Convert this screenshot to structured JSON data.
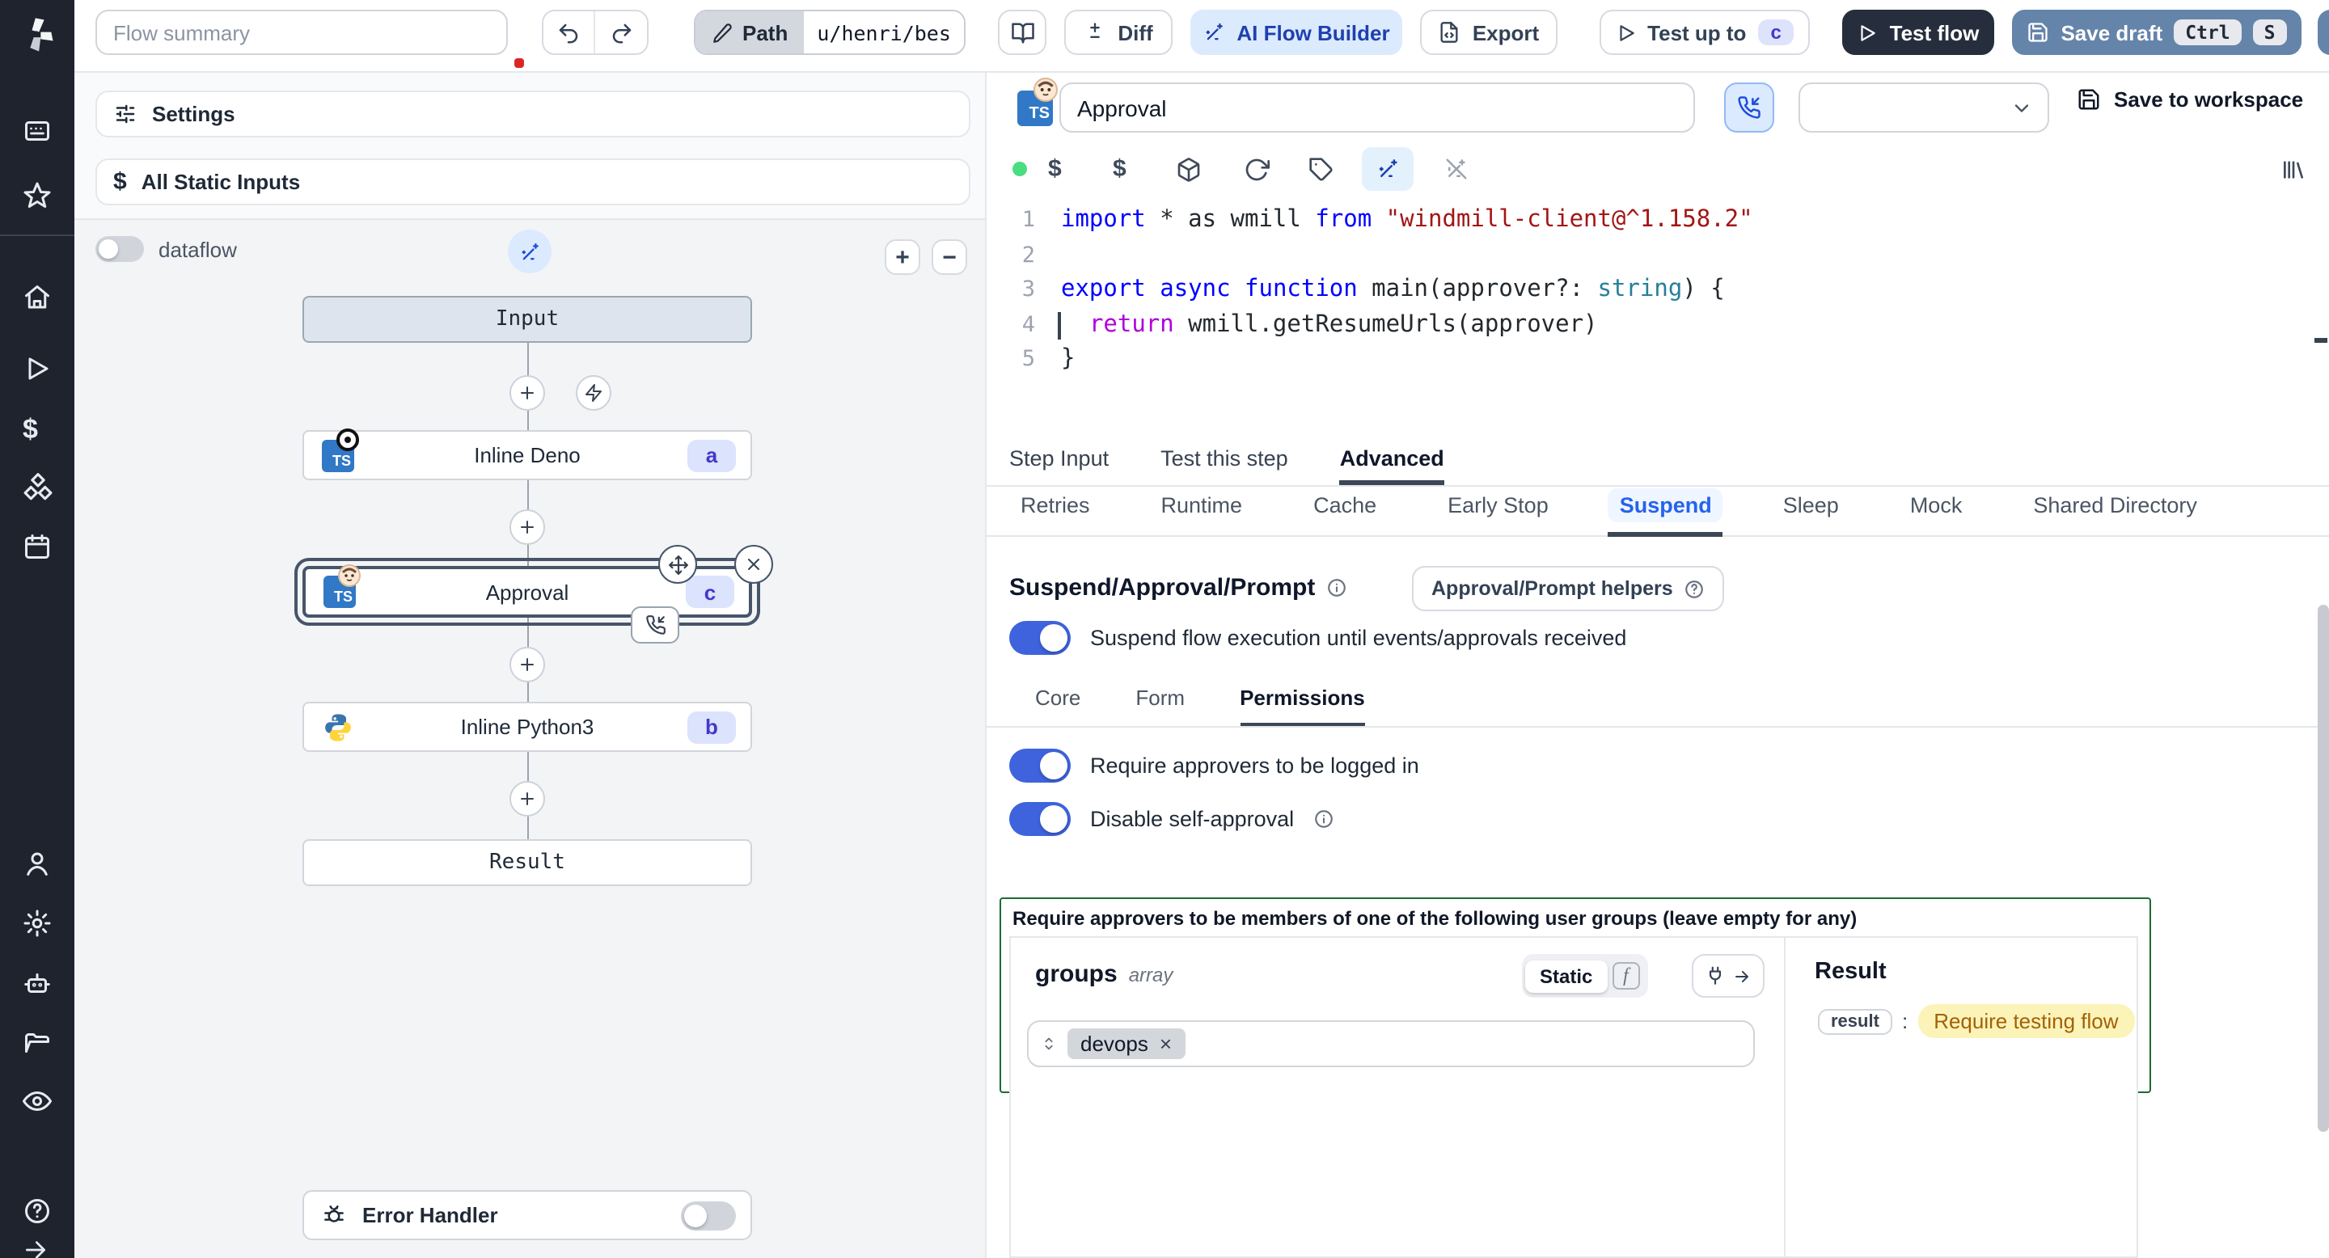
{
  "topbar": {
    "flow_summary_placeholder": "Flow summary",
    "path_label": "Path",
    "path_value": "u/henri/bes",
    "diff_label": "Diff",
    "ai_builder_label": "AI Flow Builder",
    "export_label": "Export",
    "test_up_to_label": "Test up to",
    "test_up_to_kbd": "c",
    "test_flow_label": "Test flow",
    "save_draft_label": "Save draft",
    "save_draft_kbd_1": "Ctrl",
    "save_draft_kbd_2": "S"
  },
  "flow_panel": {
    "settings_label": "Settings",
    "static_inputs_label": "All Static Inputs",
    "dataflow_label": "dataflow",
    "zoom_in": "+",
    "zoom_out": "−",
    "nodes": {
      "input": {
        "label": "Input"
      },
      "deno": {
        "label": "Inline Deno",
        "badge": "a"
      },
      "approval": {
        "label": "Approval",
        "badge": "c"
      },
      "python": {
        "label": "Inline Python3",
        "badge": "b"
      },
      "result": {
        "label": "Result"
      }
    },
    "error_handler_label": "Error Handler"
  },
  "step_header": {
    "name_value": "Approval",
    "save_to_workspace_label": "Save to workspace"
  },
  "editor": {
    "cursor_line": "4",
    "lines": [
      {
        "n": "1",
        "tokens": [
          {
            "t": "import",
            "c": "kw"
          },
          {
            "t": " * as wmill ",
            "c": "pl"
          },
          {
            "t": "from",
            "c": "kw"
          },
          {
            "t": " ",
            "c": "pl"
          },
          {
            "t": "\"windmill-client@^1.158.2\"",
            "c": "str"
          }
        ]
      },
      {
        "n": "2",
        "tokens": []
      },
      {
        "n": "3",
        "tokens": [
          {
            "t": "export",
            "c": "kw"
          },
          {
            "t": " ",
            "c": "pl"
          },
          {
            "t": "async",
            "c": "kw"
          },
          {
            "t": " ",
            "c": "pl"
          },
          {
            "t": "function",
            "c": "kw"
          },
          {
            "t": " main(approver?: ",
            "c": "pl"
          },
          {
            "t": "string",
            "c": "ty"
          },
          {
            "t": ") {",
            "c": "pl"
          }
        ]
      },
      {
        "n": "4",
        "tokens": [
          {
            "t": "  ",
            "c": "pl"
          },
          {
            "t": "return",
            "c": "ctl"
          },
          {
            "t": " wmill.getResumeUrls(approver)",
            "c": "pl"
          }
        ]
      },
      {
        "n": "5",
        "tokens": [
          {
            "t": "}",
            "c": "pl"
          }
        ]
      }
    ]
  },
  "tabs": {
    "step": [
      "Step Input",
      "Test this step",
      "Advanced"
    ],
    "advanced": [
      "Retries",
      "Runtime",
      "Cache",
      "Early Stop",
      "Suspend",
      "Sleep",
      "Mock",
      "Shared Directory"
    ]
  },
  "suspend": {
    "title": "Suspend/Approval/Prompt",
    "helpers_label": "Approval/Prompt helpers",
    "suspend_toggle_label": "Suspend flow execution until events/approvals received",
    "subtabs": [
      "Core",
      "Form",
      "Permissions"
    ],
    "logged_in_label": "Require approvers to be logged in",
    "self_approval_label": "Disable self-approval",
    "groups_box_label": "Require approvers to be members of one of the following user groups (leave empty for any)",
    "field_name": "groups",
    "field_type": "array",
    "static_label": "Static",
    "chip": "devops",
    "result_title": "Result",
    "result_key": "result",
    "result_value": "Require testing flow"
  },
  "colors": {
    "accent_blue": "#3e63dd",
    "badge_bg": "#dbe3fd",
    "badge_text": "#4338ca",
    "green_border": "#1b6b35",
    "result_badge_bg": "#fcf3b9",
    "result_badge_text": "#a16207",
    "sidebar_bg": "#1f232d",
    "save_draft_bg": "#6584aa",
    "test_flow_bg": "#262e3d"
  }
}
